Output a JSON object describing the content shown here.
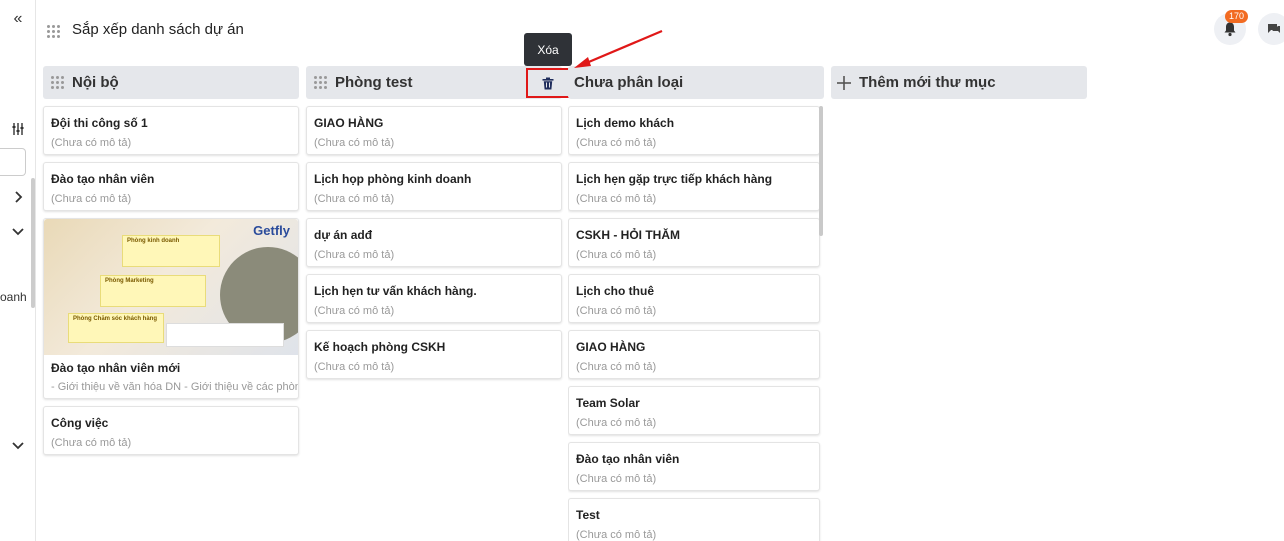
{
  "header": {
    "title": "Sắp xếp danh sách dự án",
    "notification_count": "170"
  },
  "sidebar": {
    "collapse_glyph": "«",
    "partial_text": "oanh"
  },
  "tooltip": {
    "label": "Xóa"
  },
  "columns": [
    {
      "title": "Nội bộ",
      "cards": [
        {
          "title": "Đội thi công số 1",
          "desc": "(Chưa có mô tả)"
        },
        {
          "title": "Đào tạo nhân viên",
          "desc": "(Chưa có mô tả)"
        },
        {
          "title": "Đào tạo nhân viên mới",
          "desc": "- Giới thiệu về văn hóa DN - Giới thiệu về các phòng ban..."
        },
        {
          "title": "Công việc",
          "desc": "(Chưa có mô tả)"
        }
      ]
    },
    {
      "title": "Phòng test",
      "cards": [
        {
          "title": "GIAO HÀNG",
          "desc": "(Chưa có mô tả)"
        },
        {
          "title": "Lịch họp phòng kinh doanh",
          "desc": "(Chưa có mô tả)"
        },
        {
          "title": "dự án adđ",
          "desc": "(Chưa có mô tả)"
        },
        {
          "title": "Lịch hẹn tư vấn khách hàng.",
          "desc": "(Chưa có mô tả)"
        },
        {
          "title": "Kế hoạch phòng CSKH",
          "desc": "(Chưa có mô tả)"
        }
      ]
    },
    {
      "title": "Chưa phân loại",
      "cards": [
        {
          "title": "Lịch demo khách",
          "desc": "(Chưa có mô tả)"
        },
        {
          "title": "Lịch hẹn gặp trực tiếp khách hàng",
          "desc": "(Chưa có mô tả)"
        },
        {
          "title": "CSKH - HỎI THĂM",
          "desc": "(Chưa có mô tả)"
        },
        {
          "title": "Lịch cho thuê",
          "desc": "(Chưa có mô tả)"
        },
        {
          "title": "GIAO HÀNG",
          "desc": "(Chưa có mô tả)"
        },
        {
          "title": "Team Solar",
          "desc": "(Chưa có mô tả)"
        },
        {
          "title": "Đào tạo nhân viên",
          "desc": "(Chưa có mô tả)"
        },
        {
          "title": "Test",
          "desc": "(Chưa có mô tả)"
        }
      ]
    }
  ],
  "add_folder": {
    "label": "Thêm mới thư mục"
  },
  "cover_image": {
    "logo": "Getfly",
    "box1_title": "Phòng kinh doanh",
    "box2_title": "Phòng Marketing",
    "box3_title": "Phòng Chăm sóc khách hàng"
  },
  "colors": {
    "accent_red": "#e01818",
    "badge": "#f26b21",
    "header_bg": "#e5e7eb"
  }
}
